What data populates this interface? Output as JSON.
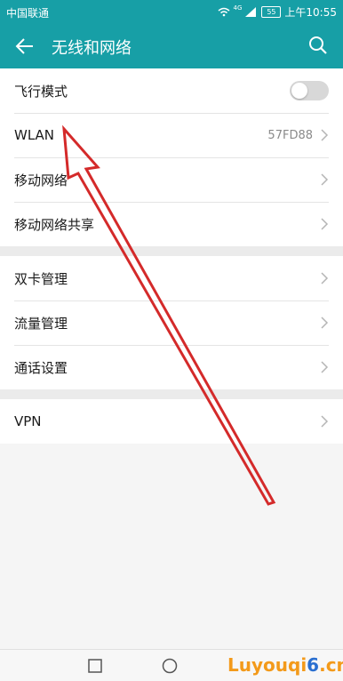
{
  "status_bar": {
    "carrier": "中国联通",
    "network": "4G",
    "battery": "55",
    "time": "上午10:55"
  },
  "header": {
    "title": "无线和网络",
    "back_icon": "arrow-left-icon",
    "search_icon": "search-icon"
  },
  "groups": [
    [
      {
        "label": "飞行模式",
        "type": "toggle",
        "on": false
      },
      {
        "label": "WLAN",
        "value": "57FD88",
        "type": "link"
      },
      {
        "label": "移动网络",
        "type": "link"
      },
      {
        "label": "移动网络共享",
        "type": "link"
      }
    ],
    [
      {
        "label": "双卡管理",
        "type": "link"
      },
      {
        "label": "流量管理",
        "type": "link"
      },
      {
        "label": "通话设置",
        "type": "link"
      }
    ],
    [
      {
        "label": "VPN",
        "type": "link"
      }
    ]
  ],
  "watermark": {
    "part1": "Luyouqi",
    "part2": "6",
    "part3": ".cn"
  },
  "colors": {
    "appbar": "#179fa6",
    "annotation_arrow": "#d42a2a"
  }
}
